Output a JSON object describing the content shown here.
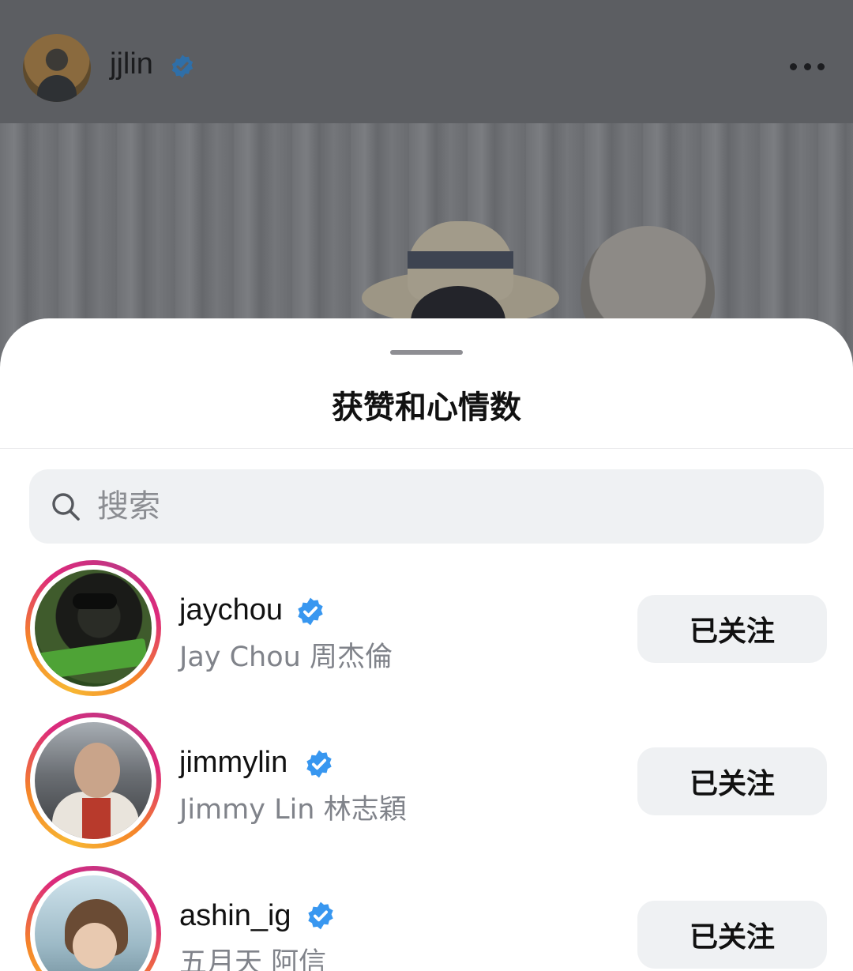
{
  "post": {
    "username": "jjlin",
    "icons": {
      "verified": "verified-badge-icon",
      "more": "more-options-icon"
    }
  },
  "sheet": {
    "title": "获赞和心情数",
    "search": {
      "placeholder": "搜索",
      "value": "",
      "icon": "search-icon"
    }
  },
  "users": [
    {
      "handle": "jaychou",
      "full_name": "Jay Chou 周杰倫",
      "verified": true,
      "button": "已关注"
    },
    {
      "handle": "jimmylin",
      "full_name": "Jimmy Lin 林志穎",
      "verified": true,
      "button": "已关注"
    },
    {
      "handle": "ashin_ig",
      "full_name": "五月天 阿信",
      "verified": true,
      "button": "已关注"
    }
  ],
  "colors": {
    "verified_blue": "#3897f0",
    "button_bg": "#eff1f3",
    "secondary_text": "#80838a",
    "story_ring_start": "#f7b733",
    "story_ring_end": "#c13584"
  }
}
